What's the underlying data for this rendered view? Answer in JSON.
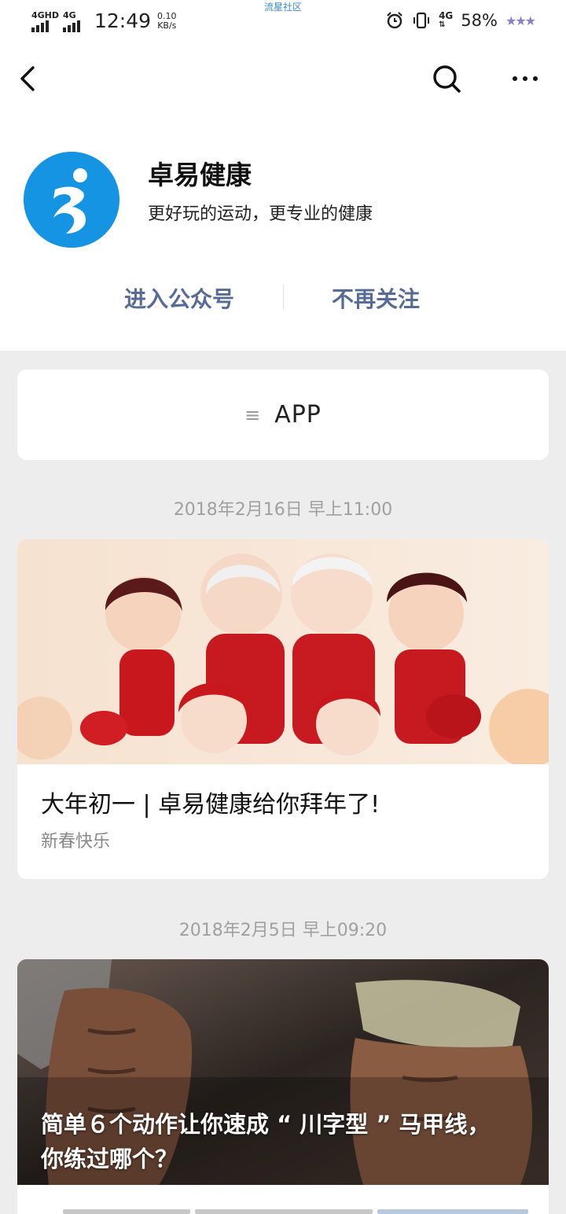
{
  "status_bar": {
    "net1": "4GHD",
    "net2": "4G",
    "time": "12:49",
    "speed_value": "0.10",
    "speed_unit": "KB/s",
    "center_text": "流星社区",
    "net3": "4G",
    "battery": "58%",
    "stars": "★★★"
  },
  "account": {
    "name": "卓易健康",
    "description": "更好玩的运动，更专业的健康"
  },
  "actions": {
    "enter": "进入公众号",
    "unfollow": "不再关注"
  },
  "menu": {
    "icon": "≡",
    "label": "APP"
  },
  "articles": [
    {
      "date": "2018年2月16日 早上11:00",
      "title": "大年初一 | 卓易健康给你拜年了!",
      "description": "新春快乐"
    },
    {
      "date": "2018年2月5日 早上09:20",
      "title_line1": "简单６个动作让你速成 “ 川字型 ” 马甲线，",
      "title_line2": "你练过哪个？"
    }
  ],
  "colors": {
    "link": "#576b95",
    "avatar_bg": "#1594e4",
    "date": "#a0a0a0"
  },
  "icons": [
    "back-arrow-icon",
    "search-icon",
    "more-icon",
    "menu-list-icon",
    "alarm-icon",
    "vibrate-icon"
  ]
}
